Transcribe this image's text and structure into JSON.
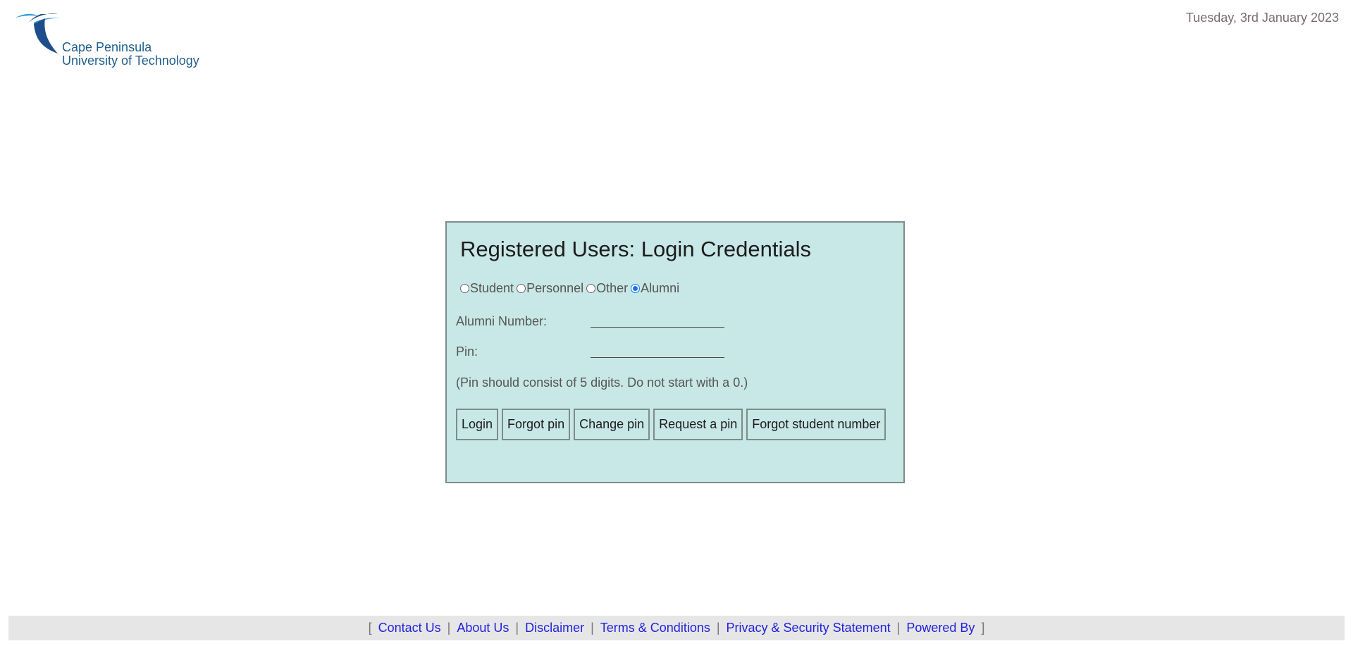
{
  "header": {
    "logo_line1": "Cape Peninsula",
    "logo_line2": "University of Technology",
    "date": "Tuesday, 3rd January 2023"
  },
  "login": {
    "title": "Registered Users: Login Credentials",
    "user_types": [
      "Student",
      "Personnel",
      "Other",
      "Alumni"
    ],
    "selected_user_type": "Alumni",
    "number_label": "Alumni Number:",
    "number_value": "",
    "pin_label": "Pin:",
    "pin_value": "",
    "hint": "(Pin should consist of 5 digits. Do not start with a 0.)",
    "buttons": {
      "login": "Login",
      "forgot_pin": "Forgot pin",
      "change_pin": "Change pin",
      "request_pin": "Request a pin",
      "forgot_student_number": "Forgot student number"
    }
  },
  "footer": {
    "open_bracket": "[",
    "close_bracket": "]",
    "separator": "|",
    "links": [
      "Contact Us",
      "About Us",
      "Disclaimer",
      "Terms & Conditions",
      "Privacy & Security Statement",
      "Powered By"
    ]
  },
  "colors": {
    "panel_bg": "#c8e7e7",
    "panel_border": "#7d8c8c",
    "brand_blue": "#1f5f8b",
    "link": "#2222dd"
  }
}
